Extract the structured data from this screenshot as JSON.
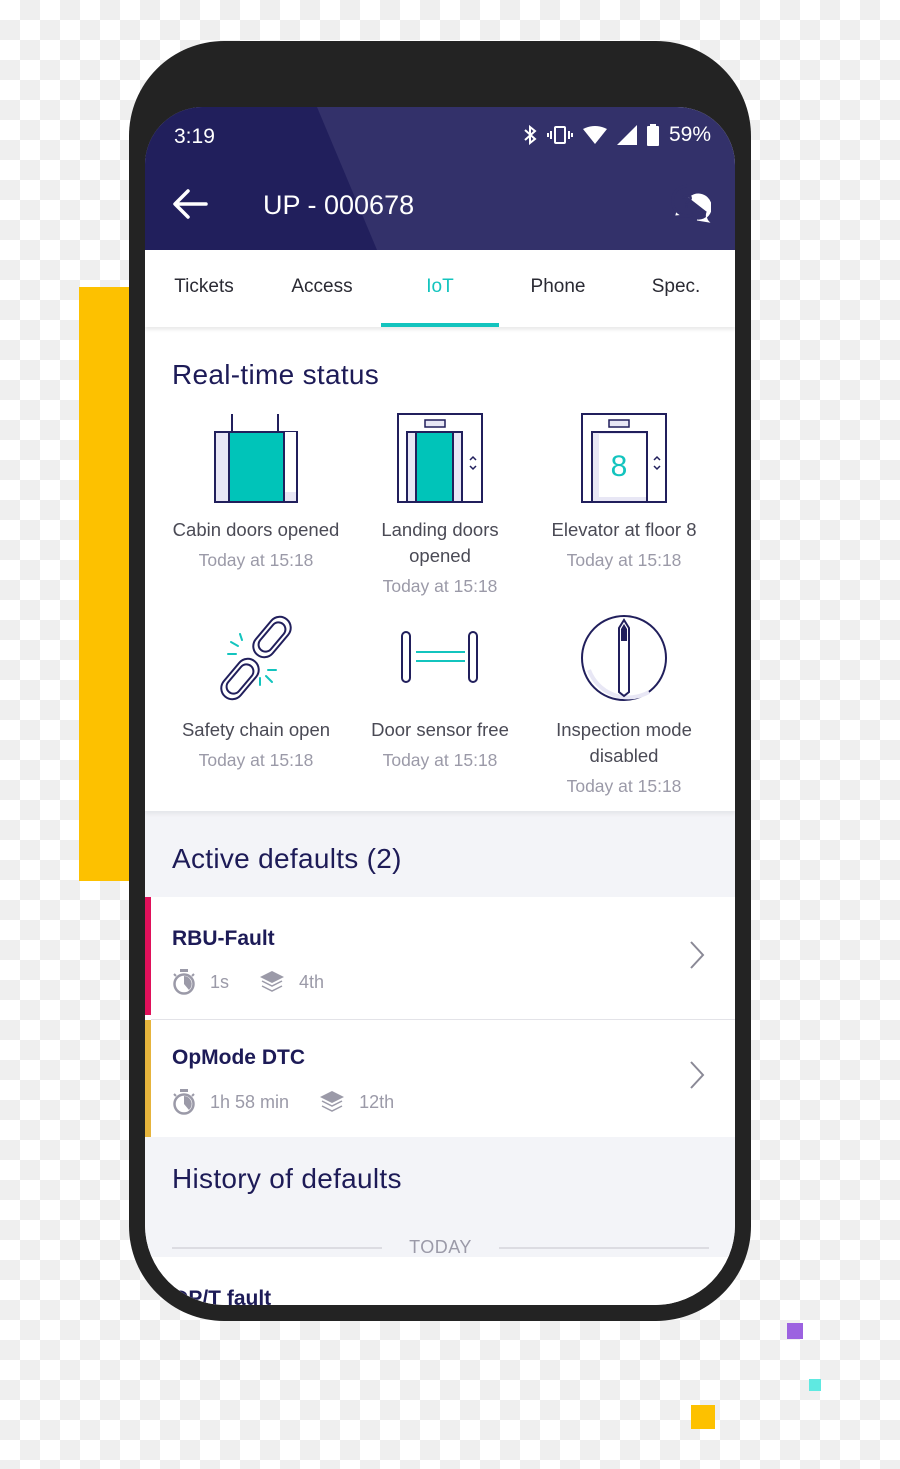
{
  "status_bar": {
    "time": "3:19",
    "battery": "59%",
    "icons": [
      "bluetooth-icon",
      "vibrate-icon",
      "wifi-icon",
      "cell-signal-icon",
      "battery-icon"
    ]
  },
  "app_bar": {
    "title": "UP - 000678",
    "back_icon": "arrow-left-icon",
    "help_icon": "help-chat-icon"
  },
  "tabs": [
    {
      "label": "Tickets",
      "active": false
    },
    {
      "label": "Access",
      "active": false
    },
    {
      "label": "IoT",
      "active": true
    },
    {
      "label": "Phone",
      "active": false
    },
    {
      "label": "Spec.",
      "active": false
    }
  ],
  "realtime": {
    "title": "Real-time status",
    "items": [
      {
        "icon": "cabin-doors-icon",
        "label": "Cabin doors opened",
        "time": "Today at 15:18"
      },
      {
        "icon": "landing-doors-icon",
        "label": "Landing doors opened",
        "time": "Today at 15:18"
      },
      {
        "icon": "elevator-floor-icon",
        "label": "Elevator at floor 8",
        "floor": "8",
        "time": "Today at 15:18"
      },
      {
        "icon": "broken-chain-icon",
        "label": "Safety chain open",
        "time": "Today at 15:18"
      },
      {
        "icon": "door-sensor-icon",
        "label": "Door sensor free",
        "time": "Today at 15:18"
      },
      {
        "icon": "inspection-switch-icon",
        "label": "Inspection mode disabled",
        "time": "Today at 15:18"
      }
    ]
  },
  "active_defaults": {
    "title": "Active defaults (2)",
    "items": [
      {
        "name": "RBU-Fault",
        "duration": "1s",
        "floor": "4th",
        "color": "#e0105a"
      },
      {
        "name": "OpMode DTC",
        "duration": "1h 58 min",
        "floor": "12th",
        "color": "#e6b43c"
      }
    ]
  },
  "history": {
    "title": "History of defaults",
    "day_label": "TODAY",
    "items": [
      {
        "name": "OP/T fault"
      }
    ]
  },
  "colors": {
    "primary_dark": "#211f5c",
    "primary": "#33316a",
    "accent": "#13c4be",
    "text_dark": "#1d1b57"
  }
}
